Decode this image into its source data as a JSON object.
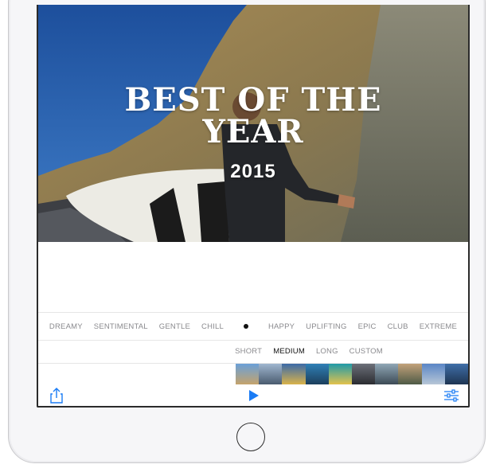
{
  "hero": {
    "title_line1": "BEST OF THE",
    "title_line2": "YEAR",
    "year": "2015"
  },
  "moods": {
    "left": [
      "DREAMY",
      "SENTIMENTAL",
      "GENTLE",
      "CHILL"
    ],
    "right": [
      "HAPPY",
      "UPLIFTING",
      "EPIC",
      "CLUB",
      "EXTREME"
    ]
  },
  "lengths": {
    "options": [
      "SHORT",
      "MEDIUM",
      "LONG",
      "CUSTOM"
    ],
    "selected": "MEDIUM"
  },
  "toolbar": {
    "share_icon": "share-icon",
    "play_icon": "play-icon",
    "adjust_icon": "sliders-icon"
  },
  "colors": {
    "accent": "#1a7cf5",
    "text_muted": "#8a8a8e",
    "text_selected": "#111111"
  }
}
